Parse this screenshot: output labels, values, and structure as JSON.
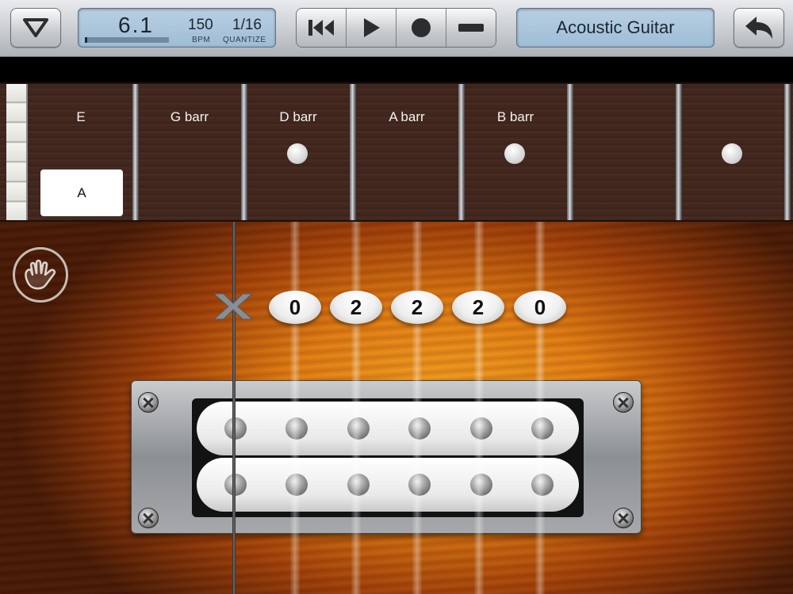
{
  "toolbar": {
    "lcd": {
      "position": "6.1",
      "tempo_value": "150",
      "tempo_caption": "BPM",
      "quantize_value": "1/16",
      "quantize_caption": "QUANTIZE",
      "progress_fraction": 0.03
    },
    "instrument_name": "Acoustic Guitar",
    "icons": {
      "menu": "triangle-down-icon",
      "rewind": "rewind-icon",
      "play": "play-icon",
      "record": "record-icon",
      "stop": "stop-icon",
      "back": "back-arrow-icon"
    }
  },
  "fretboard": {
    "chords": [
      {
        "label": "E"
      },
      {
        "label": "G barr"
      },
      {
        "label": "D barr"
      },
      {
        "label": "A barr"
      },
      {
        "label": "B barr"
      },
      {
        "label": ""
      },
      {
        "label": ""
      }
    ],
    "selected_chord": "A"
  },
  "strings": {
    "muted_symbol": "×",
    "fret_numbers": [
      "0",
      "2",
      "2",
      "2",
      "0"
    ]
  },
  "controls": {
    "hand_icon": "hand-icon"
  },
  "colors": {
    "lcd": "#a8c4dc",
    "sunburst_center": "#f5a623",
    "sunburst_edge": "#3c1305"
  }
}
